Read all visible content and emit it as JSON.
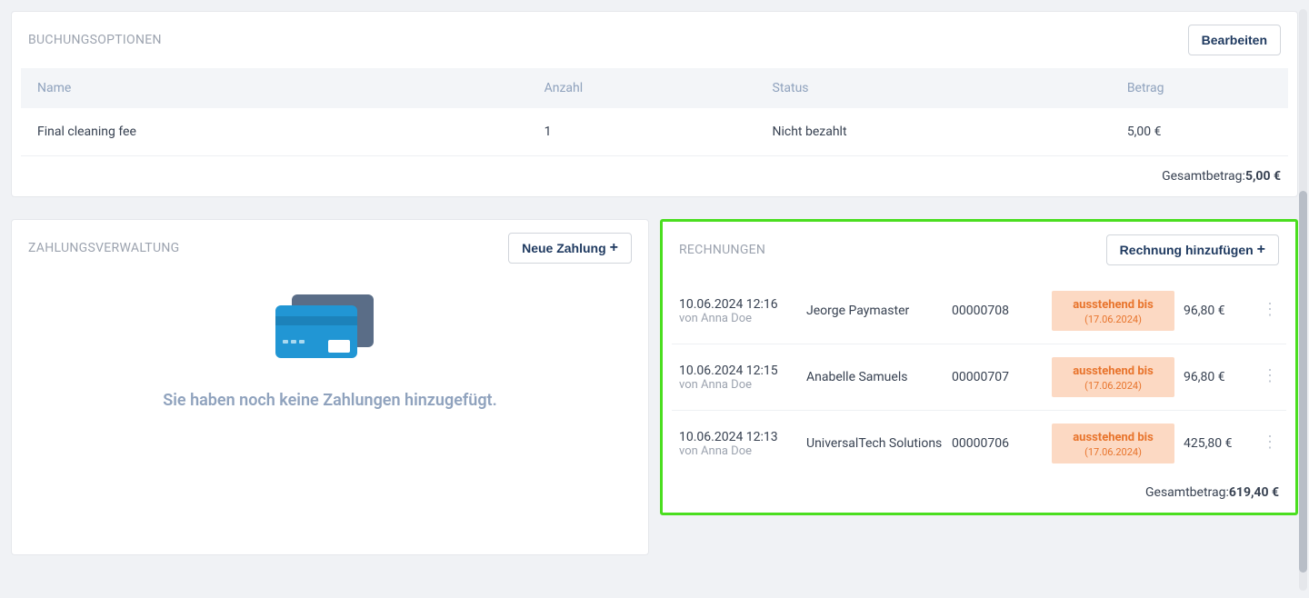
{
  "booking": {
    "title": "BUCHUNGSOPTIONEN",
    "edit_label": "Bearbeiten",
    "cols": {
      "name": "Name",
      "qty": "Anzahl",
      "status": "Status",
      "amount": "Betrag"
    },
    "rows": [
      {
        "name": "Final cleaning fee",
        "qty": "1",
        "status": "Nicht bezahlt",
        "amount": "5,00 €"
      }
    ],
    "total_label": "Gesamtbetrag:",
    "total_value": "5,00 €"
  },
  "payments": {
    "title": "ZAHLUNGSVERWALTUNG",
    "new_label": "Neue Zahlung",
    "empty_text": "Sie haben noch keine Zahlungen hinzugefügt."
  },
  "invoices": {
    "title": "RECHNUNGEN",
    "add_label": "Rechnung hinzufügen",
    "status_text": "ausstehend bis",
    "status_date": "(17.06.2024)",
    "author_prefix": "von ",
    "rows": [
      {
        "date": "10.06.2024 12:16",
        "author": "Anna Doe",
        "name": "Jeorge Paymaster",
        "num": "00000708",
        "amount": "96,80 €"
      },
      {
        "date": "10.06.2024 12:15",
        "author": "Anna Doe",
        "name": "Anabelle Samuels",
        "num": "00000707",
        "amount": "96,80 €"
      },
      {
        "date": "10.06.2024 12:13",
        "author": "Anna Doe",
        "name": "UniversalTech Solutions",
        "num": "00000706",
        "amount": "425,80 €"
      }
    ],
    "total_label": "Gesamtbetrag:",
    "total_value": "619,40 €"
  }
}
